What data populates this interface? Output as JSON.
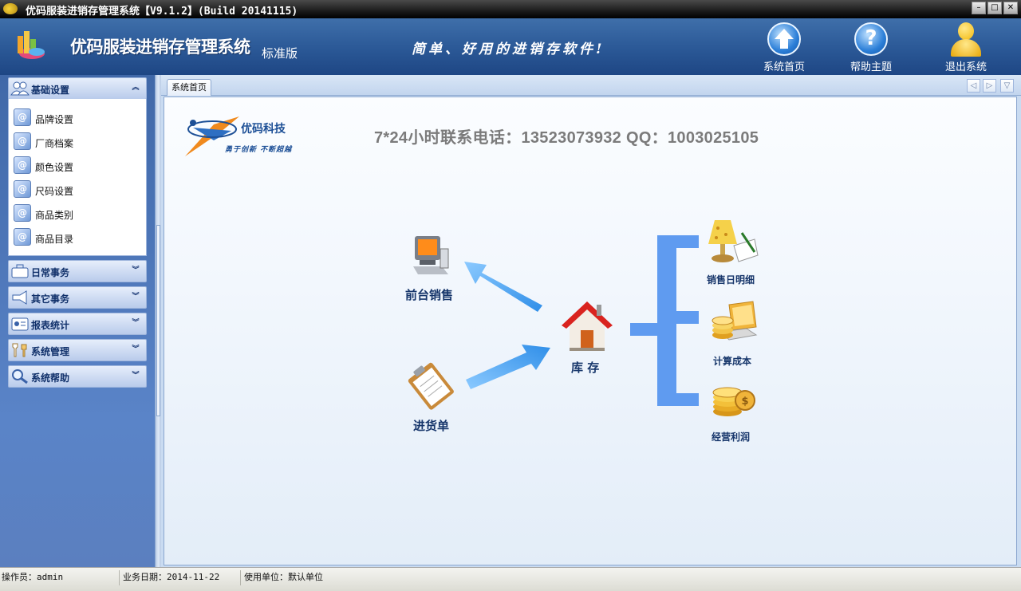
{
  "window": {
    "title": "优码服装进销存管理系统【V9.1.2】(Build 20141115)",
    "controls": [
      "–",
      "□",
      "✕"
    ]
  },
  "header": {
    "product_name": "优码服装进销存管理系统",
    "edition": "标准版",
    "slogan": "简单、好用的进销存软件!",
    "buttons": {
      "home": "系统首页",
      "help": "帮助主题",
      "logout": "退出系统"
    }
  },
  "sidebar": {
    "panels": [
      {
        "title": "基础设置",
        "expanded": true,
        "chevron": "︽"
      },
      {
        "title": "日常事务",
        "expanded": false,
        "chevron": "︾"
      },
      {
        "title": "其它事务",
        "expanded": false,
        "chevron": "︾"
      },
      {
        "title": "报表统计",
        "expanded": false,
        "chevron": "︾"
      },
      {
        "title": "系统管理",
        "expanded": false,
        "chevron": "︾"
      },
      {
        "title": "系统帮助",
        "expanded": false,
        "chevron": "︾"
      }
    ],
    "items": [
      {
        "label": "品牌设置"
      },
      {
        "label": "厂商档案"
      },
      {
        "label": "颜色设置"
      },
      {
        "label": "尺码设置"
      },
      {
        "label": "商品类别"
      },
      {
        "label": "商品目录"
      }
    ]
  },
  "tabs": [
    {
      "label": "系统首页"
    }
  ],
  "home": {
    "company_name": "优码科技",
    "company_motto": "勇于创新 不断超越",
    "contact": "7*24小时联系电话：13523073932   QQ：1003025105",
    "flow": {
      "front_sales": "前台销售",
      "purchase_order": "进货单",
      "inventory": "库  存",
      "daily_sales_detail": "销售日明细",
      "calc_cost": "计算成本",
      "operating_profit": "经营利润"
    }
  },
  "colors": {
    "header_blue": "#2c5a98",
    "flow_blue": "#5f9bf0",
    "flow_arrow": "#4aa3f0"
  },
  "statusbar": {
    "operator": "操作员：admin",
    "business_date": "业务日期：2014-11-22",
    "unit": "使用单位：默认单位"
  }
}
